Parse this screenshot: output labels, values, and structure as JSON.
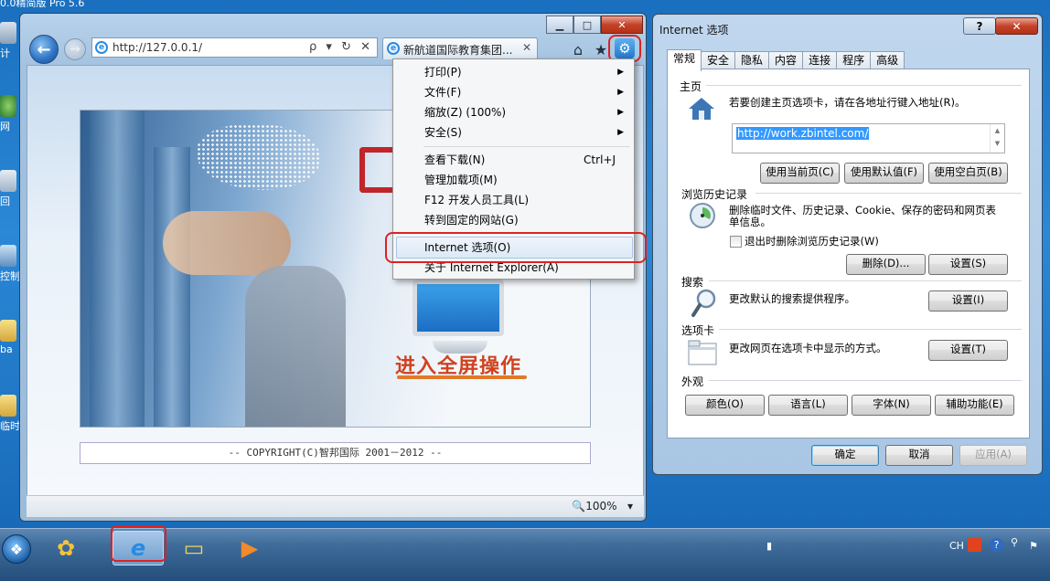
{
  "desktop": {
    "top_text": "0.0精简版    Pro 5.6",
    "icons": [
      "计",
      "网",
      "回",
      "控制",
      "ba",
      "临时"
    ]
  },
  "ie": {
    "address": "http://127.0.0.1/",
    "address_tools": "ρ ▾ ↻ ✕",
    "tab_title": "新航道国际教育集团...",
    "tab_close": "✕",
    "banner_cta": "进入全屏操作",
    "copyright": "-- COPYRIGHT(C)智邦国际 2001－2012 --",
    "zoom": "100%",
    "menu": {
      "items": [
        {
          "label": "打印(P)",
          "submenu": true
        },
        {
          "label": "文件(F)",
          "submenu": true
        },
        {
          "label": "缩放(Z) (100%)",
          "submenu": true
        },
        {
          "label": "安全(S)",
          "submenu": true
        },
        {
          "label": "查看下载(N)",
          "shortcut": "Ctrl+J"
        },
        {
          "label": "管理加载项(M)"
        },
        {
          "label": "F12 开发人员工具(L)"
        },
        {
          "label": "转到固定的网站(G)"
        },
        {
          "label": "Internet 选项(O)",
          "highlighted": true
        },
        {
          "label": "关于 Internet Explorer(A)"
        }
      ]
    }
  },
  "dialog": {
    "title": "Internet 选项",
    "help": "?",
    "close": "✕",
    "tabs": [
      "常规",
      "安全",
      "隐私",
      "内容",
      "连接",
      "程序",
      "高级"
    ],
    "home": {
      "title": "主页",
      "desc": "若要创建主页选项卡，请在各地址行键入地址(R)。",
      "url": "http://work.zbintel.com/",
      "buttons": [
        "使用当前页(C)",
        "使用默认值(F)",
        "使用空白页(B)"
      ]
    },
    "history": {
      "title": "浏览历史记录",
      "desc": "删除临时文件、历史记录、Cookie、保存的密码和网页表单信息。",
      "checkbox": "退出时删除浏览历史记录(W)",
      "buttons": [
        "删除(D)...",
        "设置(S)"
      ]
    },
    "search": {
      "title": "搜索",
      "desc": "更改默认的搜索提供程序。",
      "button": "设置(I)"
    },
    "tabsgroup": {
      "title": "选项卡",
      "desc": "更改网页在选项卡中显示的方式。",
      "button": "设置(T)"
    },
    "appearance": {
      "title": "外观",
      "buttons": [
        "颜色(O)",
        "语言(L)",
        "字体(N)",
        "辅助功能(E)"
      ]
    },
    "footer": [
      "确定",
      "取消",
      "应用(A)"
    ]
  },
  "taskbar": {
    "tray_lang": "CH"
  }
}
